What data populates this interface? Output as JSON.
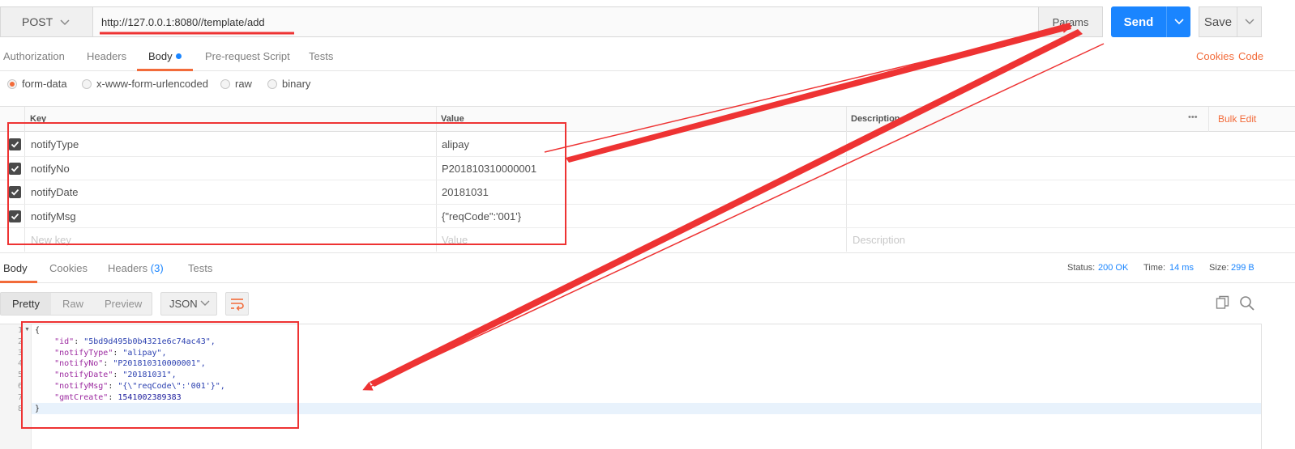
{
  "request": {
    "method": "POST",
    "url": "http://127.0.0.1:8080//template/add",
    "params_label": "Params",
    "send_label": "Send",
    "save_label": "Save"
  },
  "request_tabs": {
    "authorization": "Authorization",
    "headers": "Headers",
    "body": "Body",
    "prerequest": "Pre-request Script",
    "tests": "Tests",
    "cookies": "Cookies",
    "code": "Code"
  },
  "body_types": {
    "form_data": "form-data",
    "urlencoded": "x-www-form-urlencoded",
    "raw": "raw",
    "binary": "binary",
    "selected": "form-data"
  },
  "params_table": {
    "headers": {
      "key": "Key",
      "value": "Value",
      "description": "Description",
      "bulk_edit": "Bulk Edit",
      "more": "•••"
    },
    "rows": [
      {
        "key": "notifyType",
        "value": "alipay",
        "checked": true
      },
      {
        "key": "notifyNo",
        "value": "P201810310000001",
        "checked": true
      },
      {
        "key": "notifyDate",
        "value": "20181031",
        "checked": true
      },
      {
        "key": "notifyMsg",
        "value": "{\"reqCode\":'001'}",
        "checked": true
      }
    ],
    "placeholders": {
      "key": "New key",
      "value": "Value",
      "description": "Description"
    }
  },
  "response": {
    "tabs": {
      "body": "Body",
      "cookies": "Cookies",
      "headers": "Headers",
      "headers_count": "(3)",
      "tests": "Tests"
    },
    "status_label": "Status:",
    "status_value": "200 OK",
    "time_label": "Time:",
    "time_value": "14 ms",
    "size_label": "Size:",
    "size_value": "299 B",
    "view_modes": {
      "pretty": "Pretty",
      "raw": "Raw",
      "preview": "Preview"
    },
    "format": "JSON"
  },
  "response_body": {
    "line_numbers": [
      "1",
      "2",
      "3",
      "4",
      "5",
      "6",
      "7",
      "8"
    ],
    "lines": [
      {
        "key": "\"id\"",
        "value": "\"5bd9d495b0b4321e6c74ac43\","
      },
      {
        "key": "\"notifyType\"",
        "value": "\"alipay\","
      },
      {
        "key": "\"notifyNo\"",
        "value": "\"P201810310000001\","
      },
      {
        "key": "\"notifyDate\"",
        "value": "\"20181031\","
      },
      {
        "key": "\"notifyMsg\"",
        "value": "\"{\\\"reqCode\\\":'001'}\","
      },
      {
        "key": "\"gmtCreate\"",
        "value": "1541002389383"
      }
    ],
    "open_brace": "{",
    "close_brace": "}"
  },
  "colors": {
    "accent": "#f26b3a",
    "primary": "#1a85ff",
    "annotation": "#ee3333"
  }
}
